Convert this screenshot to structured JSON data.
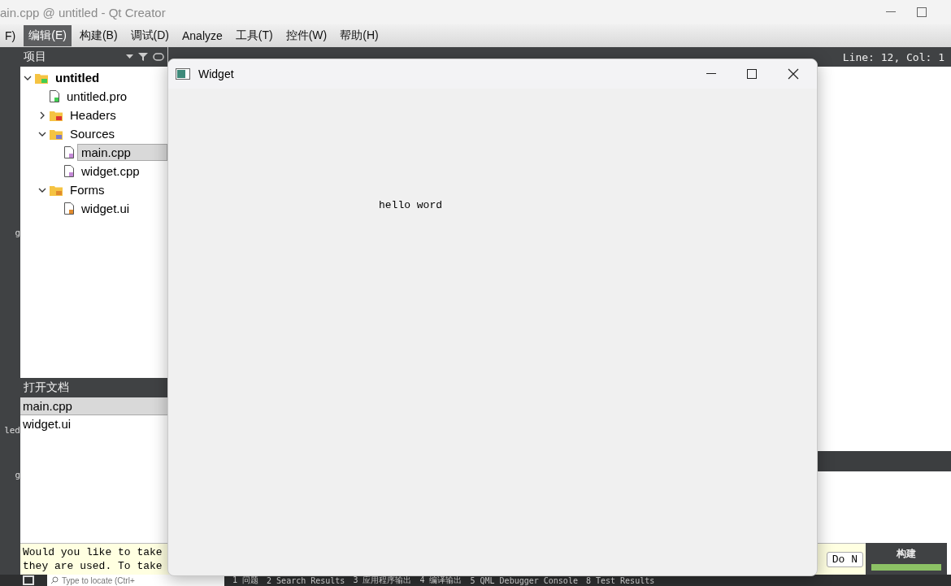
{
  "window": {
    "title": "ain.cpp @ untitled - Qt Creator"
  },
  "menu": [
    {
      "label": "F)",
      "selected": false
    },
    {
      "label": "编辑(E)",
      "selected": true
    },
    {
      "label": "构建(B)",
      "selected": false
    },
    {
      "label": "调试(D)",
      "selected": false
    },
    {
      "label": "Analyze",
      "selected": false
    },
    {
      "label": "工具(T)",
      "selected": false
    },
    {
      "label": "控件(W)",
      "selected": false
    },
    {
      "label": "帮助(H)",
      "selected": false
    }
  ],
  "mode_bar": [
    {
      "label": "g"
    },
    {
      "label": "led"
    },
    {
      "label": "g"
    }
  ],
  "projects": {
    "header": "项目",
    "tree": [
      {
        "label": "untitled",
        "kind": "project",
        "expanded": true,
        "children": [
          {
            "label": "untitled.pro",
            "kind": "pro",
            "selected": false
          },
          {
            "label": "Headers",
            "kind": "headers",
            "expanded": false
          },
          {
            "label": "Sources",
            "kind": "sources",
            "expanded": true,
            "children": [
              {
                "label": "main.cpp",
                "kind": "cpp",
                "selected": true
              },
              {
                "label": "widget.cpp",
                "kind": "cpp",
                "selected": false
              }
            ]
          },
          {
            "label": "Forms",
            "kind": "forms",
            "expanded": true,
            "children": [
              {
                "label": "widget.ui",
                "kind": "ui",
                "selected": false
              }
            ]
          }
        ]
      }
    ]
  },
  "open_documents": {
    "header": "打开文档",
    "items": [
      {
        "label": "main.cpp",
        "selected": true
      },
      {
        "label": "widget.ui",
        "selected": false
      }
    ]
  },
  "editor_toolbar": {
    "position": "Line: 12, Col: 1"
  },
  "info_bar": {
    "lines": [
      "Would you like to take",
      "they are used. To take"
    ],
    "button": "Do N"
  },
  "build": {
    "label": "构建",
    "level": 1
  },
  "locator": {
    "placeholder": "Type to locate (Ctrl+"
  },
  "output_tabs": [
    "1 问题",
    "2 Search Results",
    "3 应用程序输出",
    "4 编译输出",
    "5 QML Debugger Console",
    "8 Test Results"
  ],
  "widget_window": {
    "title": "Widget",
    "text": "hello word"
  }
}
